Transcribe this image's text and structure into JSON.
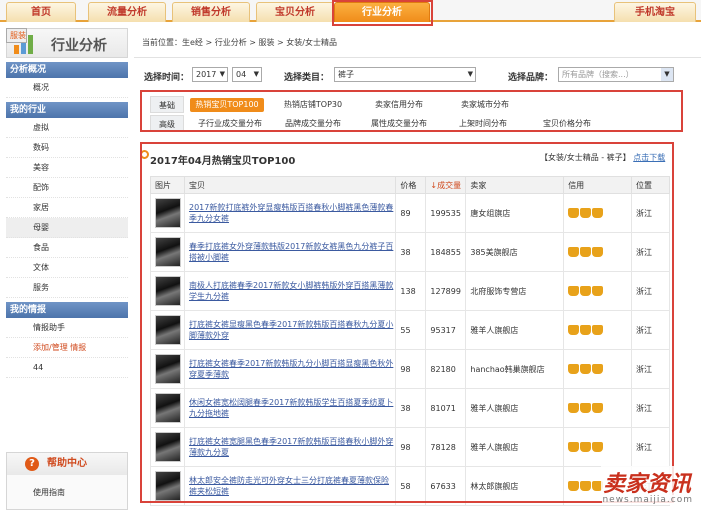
{
  "topnav": {
    "tabs": [
      "首页",
      "流量分析",
      "销售分析",
      "宝贝分析",
      "行业分析",
      "手机淘宝"
    ],
    "active_index": 4
  },
  "sidebar": {
    "title": "行业分析",
    "sections": [
      {
        "label": "分析概况",
        "items": [
          "概况"
        ]
      },
      {
        "label": "我的行业",
        "items": [
          "虚拟",
          "数码",
          "美容",
          "服装",
          "配饰",
          "家居",
          "母婴",
          "食品",
          "文体",
          "服务"
        ],
        "selected": "服装"
      },
      {
        "label": "我的情报",
        "items": [
          "情报助手",
          "添加/管理 情报",
          "44"
        ]
      }
    ],
    "help": {
      "title": "帮助中心",
      "link": "使用指南"
    }
  },
  "breadcrumb": "当前位置：生e经 > 行业分析 > 服装 > 女装/女士精品",
  "filters": {
    "time_label": "选择时间：",
    "year": "2017",
    "month": "04",
    "category_label": "选择类目：",
    "category": "裤子",
    "brand_label": "选择品牌：",
    "brand_placeholder": "所有品牌（搜索...）"
  },
  "category_tabs": {
    "row1_label": "基础",
    "row1": [
      "热销宝贝TOP100",
      "热销店铺TOP30",
      "卖家信用分布",
      "卖家城市分布"
    ],
    "row2_label": "高级",
    "row2": [
      "子行业成交量分布",
      "品牌成交量分布",
      "属性成交量分布",
      "上架时间分布",
      "宝贝价格分布"
    ],
    "active": "热销宝贝TOP100"
  },
  "section": {
    "title": "2017年04月热销宝贝TOP100",
    "scope": "【女装/女士精品 - 裤子】",
    "download": "点击下载"
  },
  "table": {
    "headers": [
      "图片",
      "宝贝",
      "价格",
      "↓成交量",
      "卖家",
      "信用",
      "位置"
    ],
    "rows": [
      {
        "title": "2017新款打底裤外穿显瘦韩版百搭春秋小脚裤黑色薄款春季九分女裤",
        "price": "89",
        "sales": "199535",
        "seller": "唐女组旗店",
        "crowns": 3,
        "location": "浙江"
      },
      {
        "title": "春季打底裤女外穿薄款韩版2017新款女裤黑色九分裤子百搭被小脚裤",
        "price": "38",
        "sales": "184855",
        "seller": "385美旗舰店",
        "crowns": 3,
        "location": "浙江"
      },
      {
        "title": "南极人打底裤春季2017新款女小脚裤韩版外穿百搭黑薄款学生九分裤",
        "price": "138",
        "sales": "127899",
        "seller": "北府服饰专营店",
        "crowns": 3,
        "location": "浙江"
      },
      {
        "title": "打底裤女裤显瘦黑色春季2017新款韩版百搭春秋九分夏小脚薄款外穿",
        "price": "55",
        "sales": "95317",
        "seller": "雅羊人旗舰店",
        "crowns": 3,
        "location": "浙江"
      },
      {
        "title": "打底裤女裤春季2017新款韩版九分小脚百搭显瘦黑色秋外穿夏季薄款",
        "price": "98",
        "sales": "82180",
        "seller": "hanchao韩巢旗舰店",
        "crowns": 3,
        "location": "浙江"
      },
      {
        "title": "休闲女裤宽松阔腿春季2017新款韩版学生百搭夏季纺夏卜九分拖地裤",
        "price": "38",
        "sales": "81071",
        "seller": "雅羊人旗舰店",
        "crowns": 3,
        "location": "浙江"
      },
      {
        "title": "打底裤女裤宽腿黑色春季2017新款韩版百搭春秋小脚外穿薄款九分夏",
        "price": "98",
        "sales": "78128",
        "seller": "雅羊人旗舰店",
        "crowns": 3,
        "location": "浙江"
      },
      {
        "title": "林太郎安全裤防走光可外穿女士三分打底裤春夏薄款保险裤夹松短裤",
        "price": "58",
        "sales": "67633",
        "seller": "林太郎旗舰店",
        "crowns": 3,
        "location": "浙江"
      }
    ]
  },
  "watermark": {
    "main": "卖家资讯",
    "sub": "news.maijia.com"
  }
}
